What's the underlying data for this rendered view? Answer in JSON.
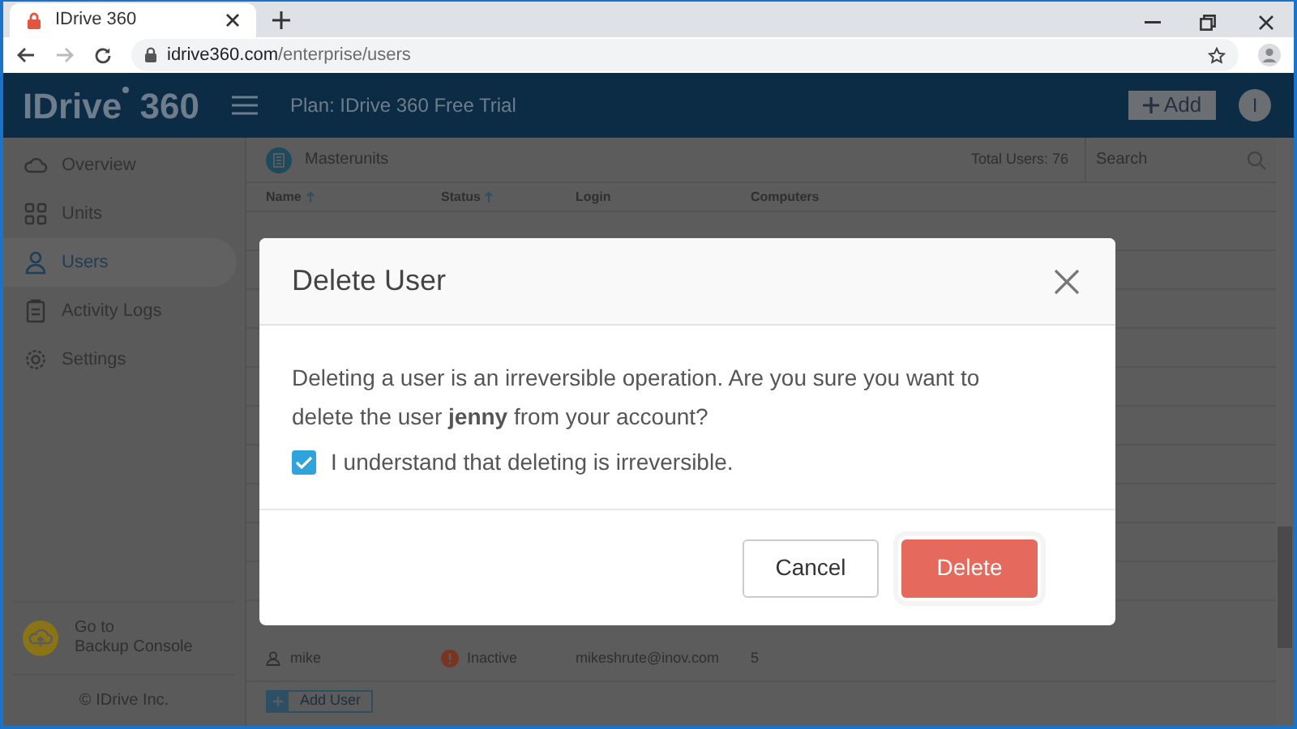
{
  "browser": {
    "tab_title": "IDrive 360",
    "url_host": "idrive360.com",
    "url_path": "/enterprise/users"
  },
  "header": {
    "logo": "IDrive",
    "logo_suffix": "360",
    "plan": "Plan: IDrive 360 Free Trial",
    "add_button": "Add",
    "avatar": "I"
  },
  "sidebar": {
    "items": [
      {
        "label": "Overview",
        "selected": false
      },
      {
        "label": "Units",
        "selected": false
      },
      {
        "label": "Users",
        "selected": true
      },
      {
        "label": "Activity Logs",
        "selected": false
      },
      {
        "label": "Settings",
        "selected": false
      }
    ],
    "backup_console": [
      "Go to",
      "Backup Console"
    ],
    "copyright": "© IDrive Inc."
  },
  "toolbar": {
    "unit": "Masterunits",
    "total": "Total Users: 76",
    "search_placeholder": "Search"
  },
  "table": {
    "columns": [
      {
        "label": "Name",
        "sorted": true
      },
      {
        "label": "Status",
        "sorted": true
      },
      {
        "label": "Login",
        "sorted": false
      },
      {
        "label": "Computers",
        "sorted": false
      }
    ],
    "rows": [
      {
        "name": "mike",
        "status": "Inactive",
        "login": "mikeshrute@inov.com",
        "computers": "5"
      }
    ],
    "add_user": "Add User"
  },
  "dialog": {
    "title": "Delete User",
    "message": "Deleting a user is an irreversible operation. Are you sure you want to delete the user **jenny** from your account?",
    "checkbox": {
      "label": "I understand that deleting is irreversible.",
      "checked": true
    },
    "buttons": [
      {
        "label": "Cancel",
        "kind": "secondary"
      },
      {
        "label": "Delete",
        "kind": "danger"
      }
    ]
  }
}
